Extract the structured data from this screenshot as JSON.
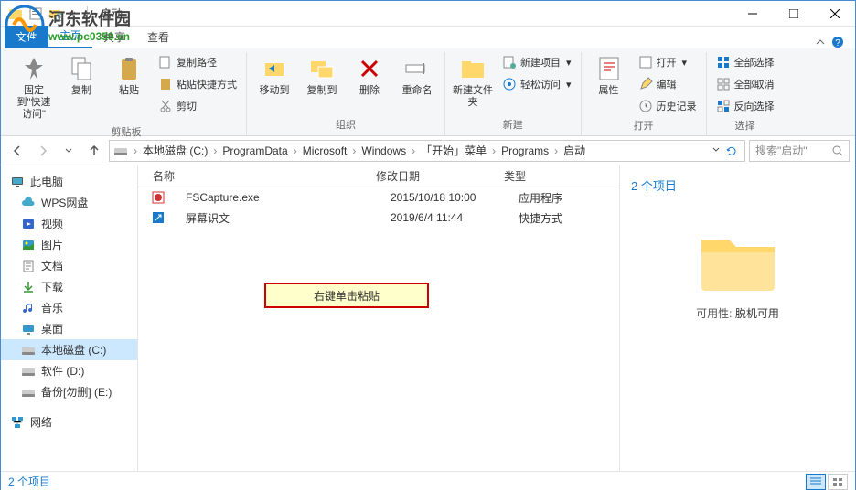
{
  "watermark": {
    "title": "河东软件园",
    "url": "www.pc0359.cn"
  },
  "titlebar": {
    "title": "启动"
  },
  "tabs": {
    "file": "文件",
    "home": "主页",
    "share": "共享",
    "view": "查看"
  },
  "ribbon": {
    "pin": "固定到\"快速访问\"",
    "copy": "复制",
    "paste": "粘贴",
    "copy_path": "复制路径",
    "paste_shortcut": "粘贴快捷方式",
    "cut": "剪切",
    "clipboard_group": "剪贴板",
    "move_to": "移动到",
    "copy_to": "复制到",
    "delete": "删除",
    "rename": "重命名",
    "organize_group": "组织",
    "new_folder": "新建文件夹",
    "new_item": "新建项目",
    "easy_access": "轻松访问",
    "new_group": "新建",
    "properties": "属性",
    "open": "打开",
    "edit": "编辑",
    "history": "历史记录",
    "open_group": "打开",
    "select_all": "全部选择",
    "select_none": "全部取消",
    "invert_selection": "反向选择",
    "select_group": "选择"
  },
  "breadcrumb": {
    "items": [
      "本地磁盘 (C:)",
      "ProgramData",
      "Microsoft",
      "Windows",
      "「开始」菜单",
      "Programs",
      "启动"
    ]
  },
  "search": {
    "placeholder": "搜索\"启动\""
  },
  "sidebar": {
    "this_pc": "此电脑",
    "wps": "WPS网盘",
    "videos": "视频",
    "pictures": "图片",
    "documents": "文档",
    "downloads": "下载",
    "music": "音乐",
    "desktop": "桌面",
    "drive_c": "本地磁盘 (C:)",
    "drive_d": "软件 (D:)",
    "drive_e": "备份[勿删] (E:)",
    "network": "网络"
  },
  "columns": {
    "name": "名称",
    "date": "修改日期",
    "type": "类型"
  },
  "files": [
    {
      "name": "FSCapture.exe",
      "date": "2015/10/18 10:00",
      "type": "应用程序",
      "icon": "app"
    },
    {
      "name": "屏幕识文",
      "date": "2019/6/4 11:44",
      "type": "快捷方式",
      "icon": "shortcut"
    }
  ],
  "callout": "右键单击粘贴",
  "details": {
    "count": "2 个项目",
    "availability_label": "可用性:",
    "availability_value": "脱机可用"
  },
  "status": {
    "count": "2 个项目"
  }
}
